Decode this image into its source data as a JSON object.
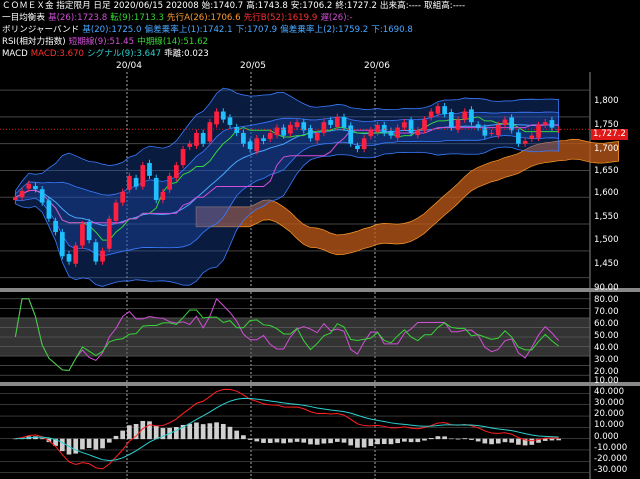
{
  "header": {
    "line1": {
      "title": "ＣＯＭＥＸ金 指定限月 日足",
      "date": "2020/06/15 202008",
      "open": "始:1740.7",
      "high": "高:1743.8",
      "low": "安:1706.2",
      "close": "終:1727.2",
      "volume": "出来高:----",
      "oi": "取組高:----"
    },
    "line2": {
      "name": "一目均衡表",
      "kijun": "基(26):1723.8",
      "tenkan": "転(9):1713.3",
      "spanA": "先行A(26):1706.6",
      "spanB": "先行B(52):1619.9",
      "chikou": "遅(26):-"
    },
    "line3": {
      "name": "ボリンジャーバンド",
      "mid": "基(20):1725.0",
      "sigma1": "偏差乗率上(1):1742.1",
      "sigma1low": "下:1707.9",
      "sigma2": "偏差乗率上(2):1759.2",
      "sigma2low": "下:1690.8"
    },
    "line4": {
      "name": "RSI(相対力指数)",
      "short": "短期線(9):51.45",
      "mid": "中期線(14):51.62"
    },
    "line5": {
      "name": "MACD",
      "macd": "MACD:3.670",
      "signal": "シグナル(9):3.647",
      "hist": "乖離:0.023"
    }
  },
  "x_labels": [
    "20/04",
    "20/05",
    "20/06"
  ],
  "price_axis": [
    "1,800",
    "1,750",
    "1,700",
    "1,650",
    "1,600",
    "1,550",
    "1,500",
    "1,450"
  ],
  "last_price": "1,727.2",
  "rsi_axis": [
    "90.00",
    "80.00",
    "70.00",
    "60.00",
    "50.00",
    "40.00",
    "30.00",
    "20.00",
    "10.00"
  ],
  "macd_axis": [
    "40.000",
    "30.000",
    "20.000",
    "10.000",
    "0.000",
    "-10.000",
    "-20.000",
    "-30.000"
  ],
  "colors": {
    "up": "#ff2040",
    "down": "#20c0ff",
    "band": "#1e4cb8",
    "cloud": "#c05a1a",
    "grid": "#444444"
  },
  "chart_data": {
    "type": "candlestick",
    "ylim": [
      1440,
      1830
    ],
    "closes": [
      1600,
      1612,
      1625,
      1615,
      1590,
      1560,
      1535,
      1490,
      1480,
      1510,
      1550,
      1520,
      1480,
      1500,
      1560,
      1590,
      1610,
      1640,
      1620,
      1660,
      1640,
      1595,
      1610,
      1640,
      1660,
      1690,
      1700,
      1720,
      1700,
      1740,
      1760,
      1745,
      1735,
      1720,
      1700,
      1690,
      1710,
      1705,
      1720,
      1730,
      1715,
      1735,
      1740,
      1725,
      1710,
      1720,
      1740,
      1735,
      1750,
      1730,
      1700,
      1690,
      1710,
      1725,
      1735,
      1720,
      1715,
      1730,
      1740,
      1720,
      1725,
      1745,
      1760,
      1770,
      1755,
      1730,
      1745,
      1760,
      1740,
      1730,
      1715,
      1720,
      1735,
      1745,
      1725,
      1700,
      1705,
      1715,
      1735,
      1740,
      1730,
      1727
    ]
  }
}
